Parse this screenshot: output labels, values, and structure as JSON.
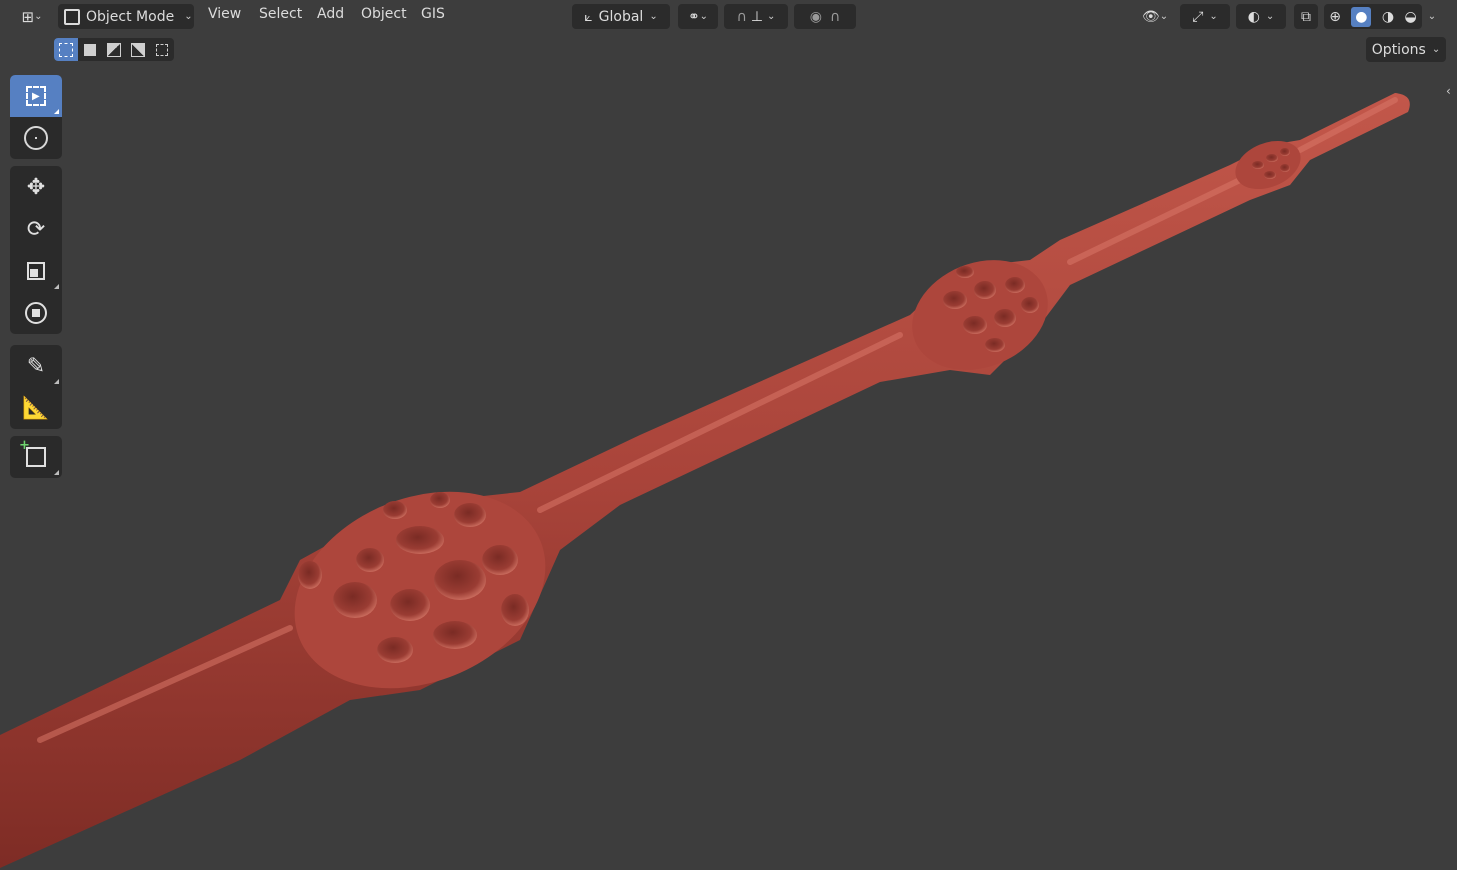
{
  "header": {
    "mode_label": "Object Mode",
    "menus": [
      "View",
      "Select",
      "Add",
      "Object",
      "GIS"
    ],
    "orientation_label": "Global",
    "options_label": "Options"
  },
  "toolbar": {
    "tools": [
      "select-box",
      "cursor",
      "move",
      "rotate",
      "scale",
      "transform",
      "annotate",
      "measure",
      "add-cube"
    ],
    "active_tool": "select-box"
  },
  "selection_modes": [
    "set",
    "extend",
    "subtract",
    "difference",
    "intersect"
  ],
  "viewport_shading": [
    "wireframe",
    "solid",
    "material-preview",
    "rendered"
  ],
  "active_shading": "solid",
  "colors": {
    "viewport_bg": "#3d3d3d",
    "accent": "#5680c2",
    "panel": "#2b2b2b",
    "object": "#b34a3e"
  }
}
